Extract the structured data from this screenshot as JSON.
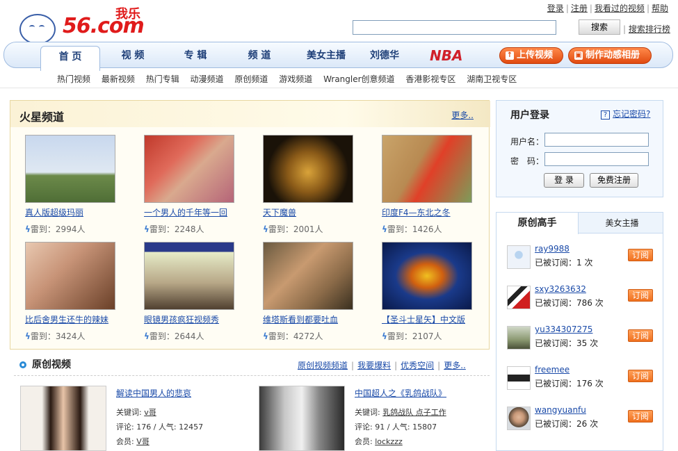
{
  "header": {
    "logo_text": "56.com",
    "logo_chinese": "我乐",
    "top_links": [
      "登录",
      "注册",
      "我看过的视频",
      "帮助"
    ],
    "search_button": "搜索",
    "rank_link": "搜索排行榜"
  },
  "nav": {
    "tabs": [
      "首 页",
      "视 频",
      "专 辑",
      "频 道",
      "美女主播",
      "刘德华"
    ],
    "nba": "NBA",
    "upload": "上传视频",
    "album": "制作动感相册"
  },
  "subnav": [
    "热门视频",
    "最新视频",
    "热门专辑",
    "动漫频道",
    "原创频道",
    "游戏频道",
    "Wrangler创意频道",
    "香港影视专区",
    "湖南卫视专区"
  ],
  "mars": {
    "title": "火星频道",
    "more": "更多..",
    "items": [
      {
        "title": "真人版超级玛丽",
        "stat": "雷到：2994人"
      },
      {
        "title": "一个男人的千年等一回",
        "stat": "雷到：2248人"
      },
      {
        "title": "天下魔兽",
        "stat": "雷到：2001人"
      },
      {
        "title": "印度F4—东北之冬",
        "stat": "雷到：1426人"
      },
      {
        "title": "比后舍男生还牛的辣妹",
        "stat": "雷到：3424人"
      },
      {
        "title": "眼镜男孩疯狂视频秀",
        "stat": "雷到：2644人"
      },
      {
        "title": "维塔斯看到都要吐血",
        "stat": "雷到：4272人"
      },
      {
        "title": "【圣斗士星矢】中文版",
        "stat": "雷到：2107人"
      }
    ]
  },
  "original": {
    "title": "原创视频",
    "links": [
      "原创视频频道",
      "我要爆料",
      "优秀空间",
      "更多.."
    ],
    "videos": [
      {
        "title": "解读中国男人的悲哀",
        "keywords_label": "关键词:",
        "keywords": "v哥",
        "comments": "评论: 176 / 人气: 12457",
        "member_label": "会员:",
        "member": "V哥"
      },
      {
        "title": "中国超人之《乳鸽战队》",
        "keywords_label": "关键词:",
        "keywords": "乳鸽战队  点子工作",
        "comments": "评论: 91 / 人气: 15807",
        "member_label": "会员:",
        "member": "lockzzz"
      }
    ]
  },
  "login": {
    "title": "用户登录",
    "forgot": "忘记密码?",
    "user_label": "用户名：",
    "pass_label": "密　码：",
    "login_btn": "登 录",
    "register_btn": "免费注册"
  },
  "experts": {
    "tab1": "原创高手",
    "tab2": "美女主播",
    "subscribe": "订阅",
    "list": [
      {
        "name": "ray9988",
        "subs": "已被订阅：1 次"
      },
      {
        "name": "sxy3263632",
        "subs": "已被订阅：786 次"
      },
      {
        "name": "yu334307275",
        "subs": "已被订阅：35 次"
      },
      {
        "name": "freemee",
        "subs": "已被订阅：176 次"
      },
      {
        "name": "wangyuanfu",
        "subs": "已被订阅：26 次"
      }
    ]
  },
  "colors": {
    "accent": "#1a4aa8",
    "brand": "#e01b1b",
    "orange": "#f0701e"
  }
}
